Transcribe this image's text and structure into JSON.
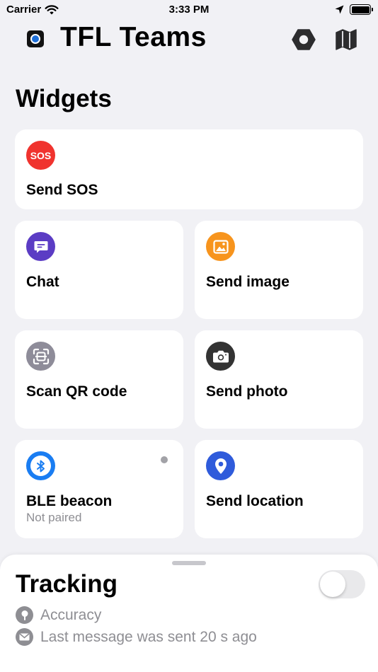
{
  "status_bar": {
    "carrier": "Carrier",
    "time": "3:33 PM"
  },
  "header": {
    "title": "TFL Teams",
    "icons": {
      "logo": "app-logo-icon",
      "settings": "hexagon-settings-icon",
      "map": "map-icon"
    }
  },
  "widgets": {
    "title": "Widgets",
    "items": [
      {
        "label": "Send SOS",
        "icon": "sos-icon",
        "icon_text": "SOS",
        "color": "#F0332E"
      },
      {
        "label": "Chat",
        "icon": "chat-bubble-icon",
        "color": "#5B3CC4"
      },
      {
        "label": "Send image",
        "icon": "image-icon",
        "color": "#F7941D"
      },
      {
        "label": "Scan QR code",
        "icon": "qr-scan-icon",
        "color": "#8E8C99"
      },
      {
        "label": "Send photo",
        "icon": "camera-icon",
        "color": "#333333"
      },
      {
        "label": "BLE beacon",
        "sublabel": "Not paired",
        "icon": "bluetooth-icon",
        "color": "#1A7DF2",
        "status_color": "#A2A2A7"
      },
      {
        "label": "Send location",
        "icon": "location-pin-icon",
        "color": "#2F5BDB"
      }
    ]
  },
  "tracking": {
    "title": "Tracking",
    "enabled": false,
    "accuracy_label": "Accuracy",
    "last_message": "Last message was sent 20 s ago"
  }
}
